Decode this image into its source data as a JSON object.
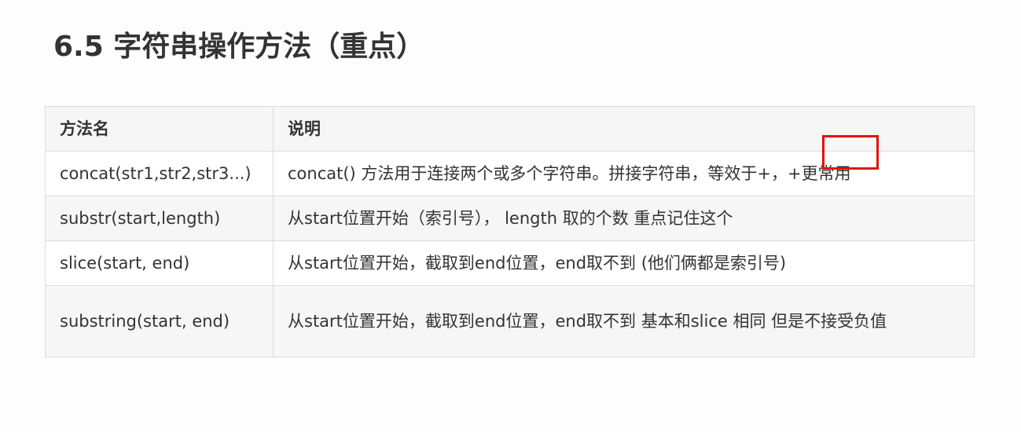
{
  "heading": "6.5 字符串操作方法（重点）",
  "table": {
    "headers": [
      "方法名",
      "说明"
    ],
    "rows": [
      {
        "method": "concat(str1,str2,str3...)",
        "desc": "concat() 方法用于连接两个或多个字符串。拼接字符串，等效于+，+更常用"
      },
      {
        "method": "substr(start,length)",
        "desc": "从start位置开始（索引号）， length 取的个数  重点记住这个"
      },
      {
        "method": "slice(start, end)",
        "desc": "从start位置开始，截取到end位置，end取不到 (他们俩都是索引号)"
      },
      {
        "method": "substring(start, end)",
        "desc": "从start位置开始，截取到end位置，end取不到  基本和slice 相同 但是不接受负值"
      }
    ]
  },
  "annotation": {
    "color": "#e3120b"
  }
}
